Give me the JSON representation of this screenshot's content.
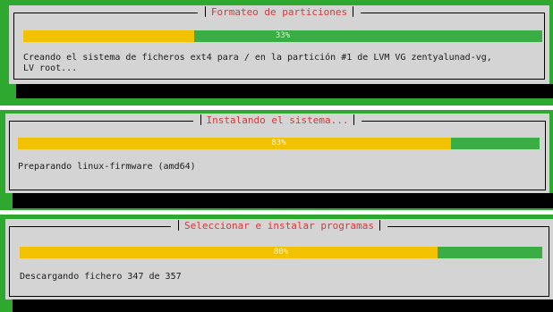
{
  "colors": {
    "background_green": "#2fa82f",
    "dialog_gray": "#d4d4d4",
    "title_red": "#d23a3a",
    "progress_yellow": "#f2c200",
    "progress_green": "#3aad45",
    "shadow_black": "#000000"
  },
  "screens": [
    {
      "title": "Formateo de particiones",
      "progress_percent_label": "33%",
      "progress_fraction": 0.33,
      "message": "Creando el sistema de ficheros ext4 para / en la partición #1 de LVM VG zentyalunad-vg,\nLV root..."
    },
    {
      "title": "Instalando el sistema...",
      "progress_percent_label": "83%",
      "progress_fraction": 0.83,
      "message": "Preparando linux-firmware (amd64)"
    },
    {
      "title": "Seleccionar e instalar programas",
      "progress_percent_label": "80%",
      "progress_fraction": 0.8,
      "message": "Descargando fichero 347 de 357"
    }
  ]
}
